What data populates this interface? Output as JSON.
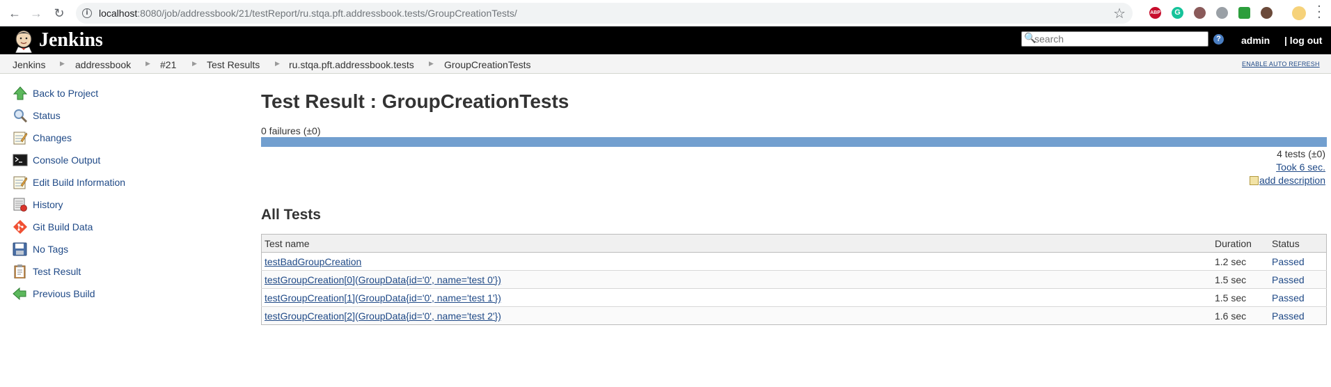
{
  "browser": {
    "url_host": "localhost",
    "url_path": ":8080/job/addressbook/21/testReport/ru.stqa.pft.addressbook.tests/GroupCreationTests/",
    "extensions": [
      "ABP",
      "G"
    ]
  },
  "header": {
    "brand": "Jenkins",
    "search_placeholder": "search",
    "help_label": "?",
    "user": "admin",
    "logout": "| log out"
  },
  "breadcrumbs": [
    "Jenkins",
    "addressbook",
    "#21",
    "Test Results",
    "ru.stqa.pft.addressbook.tests",
    "GroupCreationTests"
  ],
  "auto_refresh": "ENABLE AUTO REFRESH",
  "sidebar": {
    "items": [
      {
        "label": "Back to Project",
        "icon": "up-arrow-icon"
      },
      {
        "label": "Status",
        "icon": "magnifier-icon"
      },
      {
        "label": "Changes",
        "icon": "notepad-icon"
      },
      {
        "label": "Console Output",
        "icon": "terminal-icon"
      },
      {
        "label": "Edit Build Information",
        "icon": "notepad-icon"
      },
      {
        "label": "History",
        "icon": "history-icon"
      },
      {
        "label": "Git Build Data",
        "icon": "git-icon"
      },
      {
        "label": "No Tags",
        "icon": "save-icon"
      },
      {
        "label": "Test Result",
        "icon": "clipboard-icon"
      },
      {
        "label": "Previous Build",
        "icon": "left-arrow-icon"
      }
    ]
  },
  "main": {
    "title": "Test Result : GroupCreationTests",
    "failures": "0 failures (±0)",
    "pass_fraction": 1.0,
    "tests_count": "4 tests (±0)",
    "took": "Took 6 sec.",
    "add_description": "add description",
    "all_tests_heading": "All Tests",
    "table": {
      "headers": [
        "Test name",
        "Duration",
        "Status"
      ],
      "rows": [
        {
          "name": "testBadGroupCreation",
          "duration": "1.2 sec",
          "status": "Passed"
        },
        {
          "name": "testGroupCreation[0](GroupData{id='0', name='test 0'})",
          "duration": "1.5 sec",
          "status": "Passed"
        },
        {
          "name": "testGroupCreation[1](GroupData{id='0', name='test 1'})",
          "duration": "1.5 sec",
          "status": "Passed"
        },
        {
          "name": "testGroupCreation[2](GroupData{id='0', name='test 2'})",
          "duration": "1.6 sec",
          "status": "Passed"
        }
      ]
    }
  },
  "colors": {
    "link": "#204a87",
    "progress_pass": "#729fcf",
    "header_bg": "#000000"
  }
}
